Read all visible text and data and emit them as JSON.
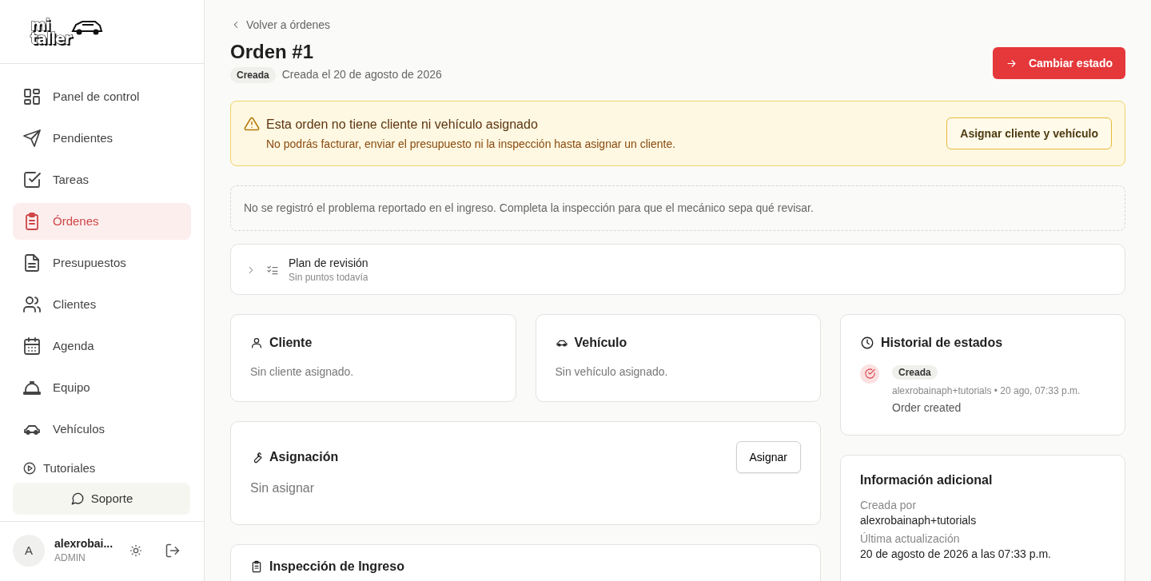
{
  "logo": {
    "line1": "mi",
    "line2": "taller"
  },
  "sidebar": {
    "items": [
      {
        "label": "Panel de control",
        "selected": false
      },
      {
        "label": "Pendientes",
        "selected": false
      },
      {
        "label": "Tareas",
        "selected": false
      },
      {
        "label": "Órdenes",
        "selected": true
      },
      {
        "label": "Presupuestos",
        "selected": false
      },
      {
        "label": "Clientes",
        "selected": false
      },
      {
        "label": "Agenda",
        "selected": false
      },
      {
        "label": "Equipo",
        "selected": false
      },
      {
        "label": "Vehículos",
        "selected": false
      }
    ],
    "tutorials": "Tutoriales",
    "support": "Soporte",
    "user": {
      "avatar": "A",
      "name": "alexrobai...",
      "role": "ADMIN"
    }
  },
  "header": {
    "back": "Volver a órdenes",
    "title": "Orden #1",
    "status": "Creada",
    "created": "Creada el 20 de agosto de 2026",
    "action": "Cambiar estado"
  },
  "alert": {
    "title": "Esta orden no tiene cliente ni vehículo asignado",
    "text": "No podrás facturar, enviar el presupuesto ni la inspección hasta asignar un cliente.",
    "button": "Asignar cliente y vehículo"
  },
  "notice": "No se registró el problema reportado en el ingreso. Completa la inspección para que el mecánico sepa qué revisar.",
  "plan": {
    "title": "Plan de revisión",
    "subtitle": "Sin puntos todavía",
    "expanded": false
  },
  "client": {
    "title": "Cliente",
    "text": "Sin cliente asignado."
  },
  "vehicle": {
    "title": "Vehículo",
    "text": "Sin vehículo asignado."
  },
  "assignment": {
    "title": "Asignación",
    "button": "Asignar",
    "text": "Sin asignar"
  },
  "inspection": {
    "title": "Inspección de Ingreso"
  },
  "history": {
    "title": "Historial de estados",
    "entries": [
      {
        "status": "Creada",
        "meta": "alexrobainaph+tutorials • 20 ago, 07:33 p.m.",
        "note": "Order created"
      }
    ]
  },
  "info": {
    "title": "Información adicional",
    "fields": [
      {
        "label": "Creada por",
        "value": "alexrobainaph+tutorials"
      },
      {
        "label": "Última actualización",
        "value": "20 de agosto de 2026 a las 07:33 p.m."
      }
    ]
  }
}
